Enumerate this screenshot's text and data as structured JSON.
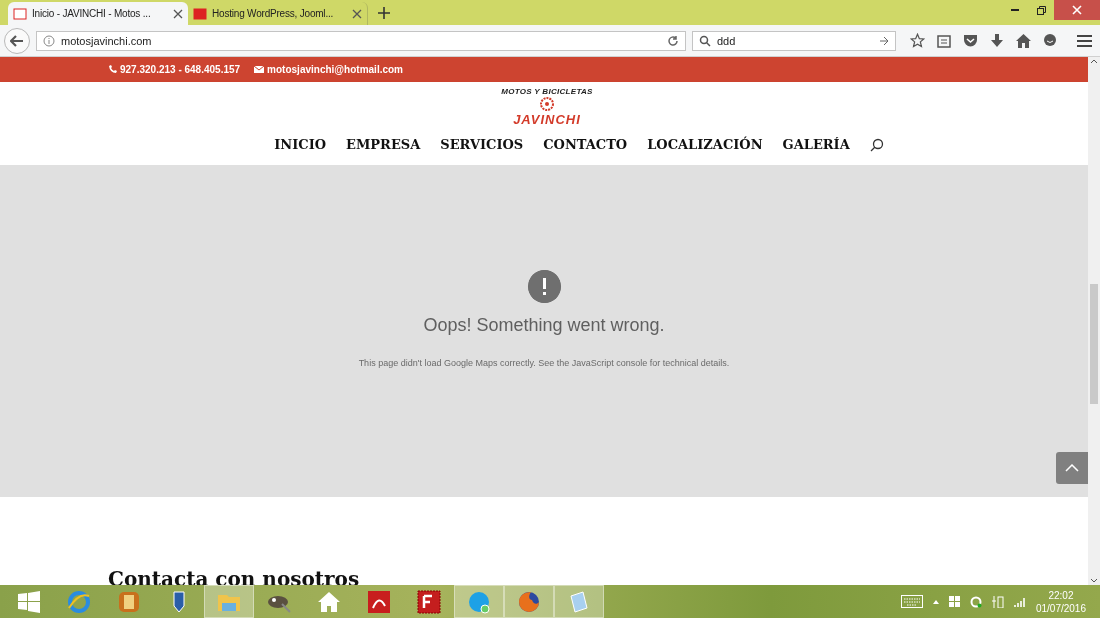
{
  "browser": {
    "tabs": [
      {
        "title": "Inicio - JAVINCHI - Motos ...",
        "selected": true
      },
      {
        "title": "Hosting WordPress, Jooml...",
        "selected": false
      }
    ],
    "address": "motosjavinchi.com",
    "search": "ddd"
  },
  "topbar": {
    "phone": "927.320.213 - 648.405.157",
    "email": "motosjavinchi@hotmail.com"
  },
  "logo": {
    "tagline": "MOTOS Y BICICLETAS",
    "name": "JAVINCHI"
  },
  "nav": [
    {
      "label": "INICIO"
    },
    {
      "label": "EMPRESA"
    },
    {
      "label": "SERVICIOS"
    },
    {
      "label": "CONTACTO"
    },
    {
      "label": "LOCALIZACIÓN"
    },
    {
      "label": "GALERÍA"
    }
  ],
  "map_error": {
    "title": "Oops! Something went wrong.",
    "message": "This page didn't load Google Maps correctly. See the JavaScript console for technical details."
  },
  "section_heading": "Contacta con nosotros",
  "taskbar": {
    "apps": [
      {
        "kind": "ie",
        "active": false
      },
      {
        "kind": "archive",
        "active": false
      },
      {
        "kind": "pen",
        "active": false
      },
      {
        "kind": "folder",
        "active": true
      },
      {
        "kind": "gimp",
        "active": false
      },
      {
        "kind": "home",
        "active": false
      },
      {
        "kind": "pdf",
        "active": false
      },
      {
        "kind": "ftp",
        "active": false
      },
      {
        "kind": "skype",
        "active": true
      },
      {
        "kind": "firefox",
        "active": true
      },
      {
        "kind": "notepad",
        "active": true
      }
    ],
    "time": "22:02",
    "date": "01/07/2016"
  }
}
